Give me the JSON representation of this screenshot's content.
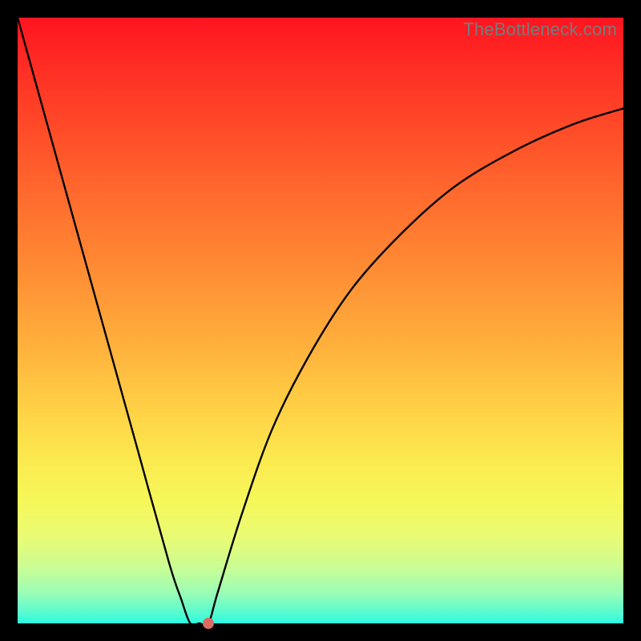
{
  "watermark": "TheBottleneck.com",
  "chart_data": {
    "type": "line",
    "title": "",
    "xlabel": "",
    "ylabel": "",
    "xlim": [
      0,
      100
    ],
    "ylim": [
      0,
      100
    ],
    "x": [
      0,
      5,
      10,
      15,
      20,
      25,
      27,
      28.5,
      30,
      31.5,
      33,
      37,
      42,
      48,
      55,
      63,
      72,
      82,
      92,
      100
    ],
    "values": [
      100,
      82,
      64,
      46,
      28,
      10,
      4,
      0,
      0,
      0,
      5,
      18,
      32,
      44,
      55,
      64,
      72,
      78,
      82.5,
      85
    ],
    "marker": {
      "x": 31.5,
      "y": 0
    },
    "annotations": []
  },
  "colors": {
    "curve": "#000000",
    "marker": "#d96b62",
    "frame": "#000000"
  }
}
